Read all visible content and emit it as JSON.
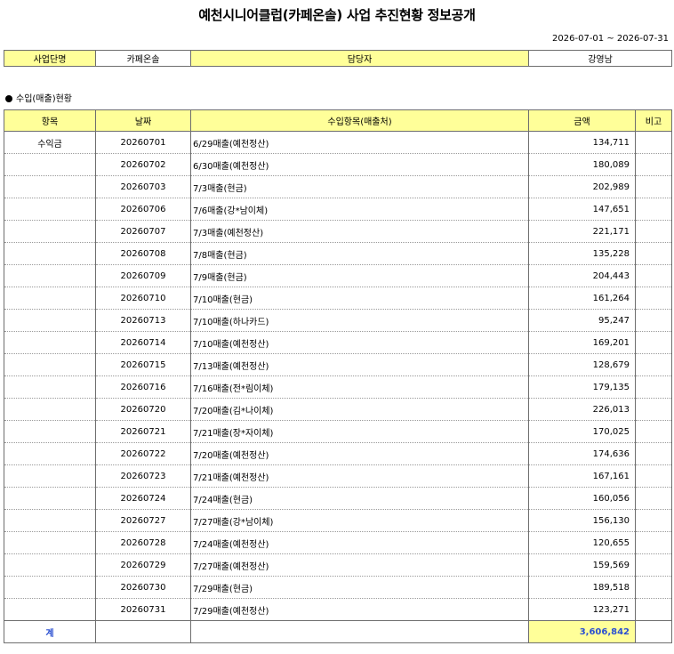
{
  "title": "예천시니어클럽(카페온솔) 사업 추진현황 정보공개",
  "period": "2026-07-01 ~ 2026-07-31",
  "info": {
    "project_label": "사업단명",
    "project_value": "카페온솔",
    "manager_label": "담당자",
    "manager_value": "강영남"
  },
  "section_title": "수입(매출)현황",
  "headers": {
    "item": "항목",
    "date": "날짜",
    "source": "수입항목(매출처)",
    "amount": "금액",
    "note": "비고"
  },
  "category": "수익금",
  "rows": [
    {
      "date": "20260701",
      "desc": "6/29매출(예천정산)",
      "amount": "134,711"
    },
    {
      "date": "20260702",
      "desc": "6/30매출(예천정산)",
      "amount": "180,089"
    },
    {
      "date": "20260703",
      "desc": "7/3매출(현금)",
      "amount": "202,989"
    },
    {
      "date": "20260706",
      "desc": "7/6매출(강*남이체)",
      "amount": "147,651"
    },
    {
      "date": "20260707",
      "desc": "7/3매출(예천정산)",
      "amount": "221,171"
    },
    {
      "date": "20260708",
      "desc": "7/8매출(현금)",
      "amount": "135,228"
    },
    {
      "date": "20260709",
      "desc": "7/9매출(현금)",
      "amount": "204,443"
    },
    {
      "date": "20260710",
      "desc": "7/10매출(현금)",
      "amount": "161,264"
    },
    {
      "date": "20260713",
      "desc": "7/10매출(하나카드)",
      "amount": "95,247"
    },
    {
      "date": "20260714",
      "desc": "7/10매출(예천정산)",
      "amount": "169,201"
    },
    {
      "date": "20260715",
      "desc": "7/13매출(예천정산)",
      "amount": "128,679"
    },
    {
      "date": "20260716",
      "desc": "7/16매출(전*림이체)",
      "amount": "179,135"
    },
    {
      "date": "20260720",
      "desc": "7/20매출(김*나이체)",
      "amount": "226,013"
    },
    {
      "date": "20260721",
      "desc": "7/21매출(장*자이체)",
      "amount": "170,025"
    },
    {
      "date": "20260722",
      "desc": "7/20매출(예천정산)",
      "amount": "174,636"
    },
    {
      "date": "20260723",
      "desc": "7/21매출(예천정산)",
      "amount": "167,161"
    },
    {
      "date": "20260724",
      "desc": "7/24매출(현금)",
      "amount": "160,056"
    },
    {
      "date": "20260727",
      "desc": "7/27매출(강*남이체)",
      "amount": "156,130"
    },
    {
      "date": "20260728",
      "desc": "7/24매출(예천정산)",
      "amount": "120,655"
    },
    {
      "date": "20260729",
      "desc": "7/27매출(예천정산)",
      "amount": "159,569"
    },
    {
      "date": "20260730",
      "desc": "7/29매출(현금)",
      "amount": "189,518"
    },
    {
      "date": "20260731",
      "desc": "7/29매출(예천정산)",
      "amount": "123,271"
    }
  ],
  "total": {
    "label": "계",
    "amount": "3,606,842"
  },
  "colors": {
    "header_fill": "#ffff99",
    "total_text": "#2a4fd1"
  }
}
